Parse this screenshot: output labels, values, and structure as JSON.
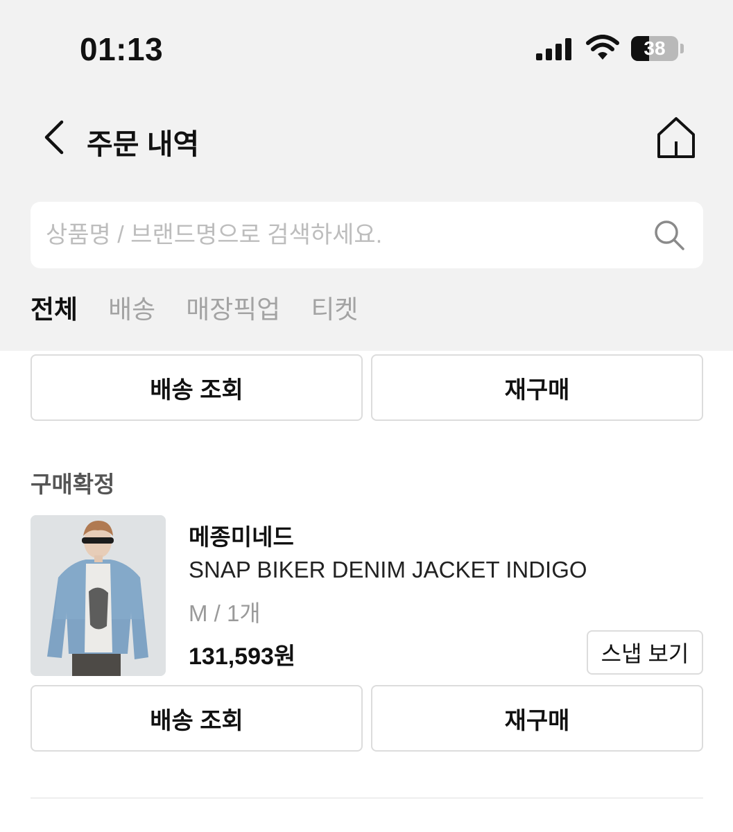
{
  "status_bar": {
    "time": "01:13",
    "battery": "38",
    "battery_level": 0.38,
    "signal_icon": "signal-bars-icon",
    "wifi_icon": "wifi-icon"
  },
  "nav": {
    "title": "주문 내역",
    "back_icon": "chevron-left-icon",
    "home_icon": "home-icon"
  },
  "search": {
    "placeholder": "상품명 / 브랜드명으로 검색하세요.",
    "value": "",
    "icon": "search-icon"
  },
  "tabs": [
    {
      "label": "전체",
      "active": true
    },
    {
      "label": "배송",
      "active": false
    },
    {
      "label": "매장픽업",
      "active": false
    },
    {
      "label": "티켓",
      "active": false
    }
  ],
  "orders": [
    {
      "actions": {
        "track": "배송 조회",
        "rebuy": "재구매"
      }
    },
    {
      "status": "구매확정",
      "brand": "메종미네드",
      "product": "SNAP BIKER DENIM JACKET INDIGO",
      "option": "M / 1개",
      "price": "131,593원",
      "snap_label": "스냅 보기",
      "actions": {
        "track": "배송 조회",
        "rebuy": "재구매"
      }
    }
  ],
  "colors": {
    "header_bg": "#f2f2f2",
    "active_tab": "#111111",
    "inactive_tab": "#a3a3a3",
    "button_border": "#dcdcdc"
  }
}
